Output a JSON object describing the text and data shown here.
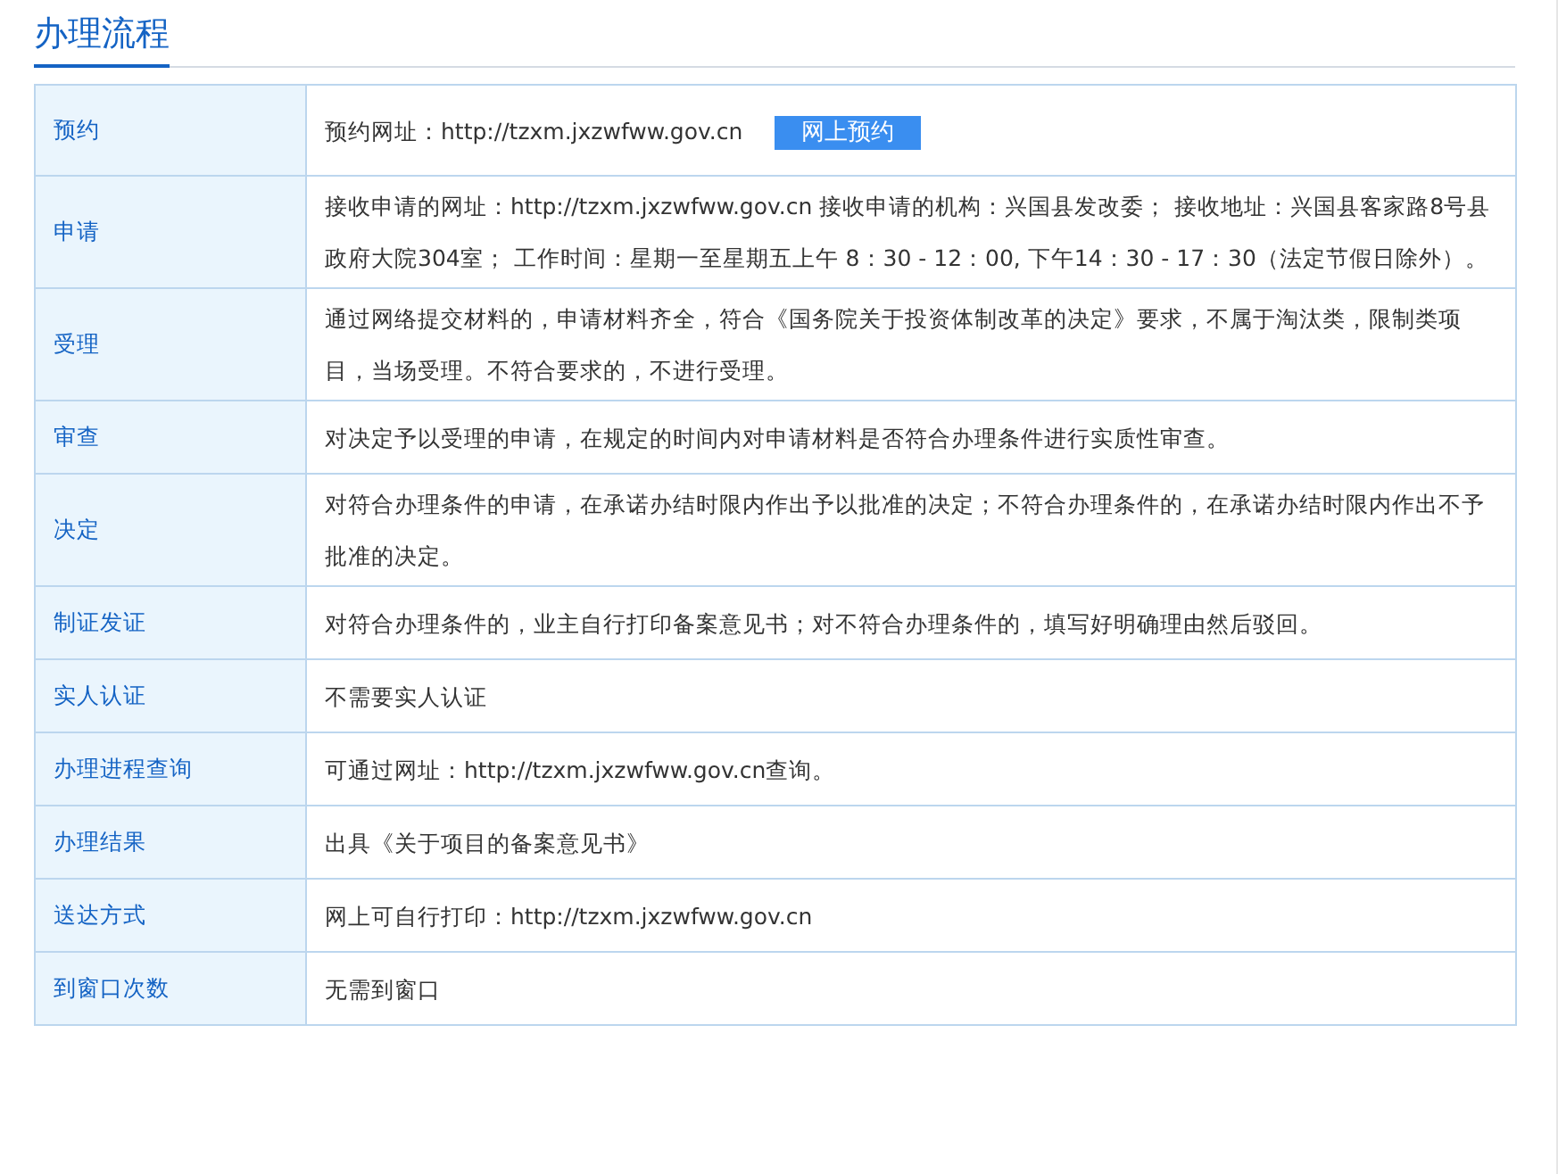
{
  "section_title": "办理流程",
  "rows": [
    {
      "label": "预约",
      "text": "预约网址：http://tzxm.jxzwfww.gov.cn",
      "button": "网上预约"
    },
    {
      "label": "申请",
      "text": "接收申请的网址：http://tzxm.jxzwfww.gov.cn 接收申请的机构：兴国县发改委； 接收地址：兴国县客家路8号县政府大院304室； 工作时间：星期一至星期五上午 8：30 - 12：00, 下午14：30 - 17：30（法定节假日除外）。"
    },
    {
      "label": "受理",
      "text": "通过网络提交材料的，申请材料齐全，符合《国务院关于投资体制改革的决定》要求，不属于淘汰类，限制类项目，当场受理。不符合要求的，不进行受理。"
    },
    {
      "label": "审查",
      "text": "对决定予以受理的申请，在规定的时间内对申请材料是否符合办理条件进行实质性审查。"
    },
    {
      "label": "决定",
      "text": "对符合办理条件的申请，在承诺办结时限内作出予以批准的决定；不符合办理条件的，在承诺办结时限内作出不予批准的决定。"
    },
    {
      "label": "制证发证",
      "text": "对符合办理条件的，业主自行打印备案意见书；对不符合办理条件的，填写好明确理由然后驳回。"
    },
    {
      "label": "实人认证",
      "text": "不需要实人认证"
    },
    {
      "label": "办理进程查询",
      "text": "可通过网址：http://tzxm.jxzwfww.gov.cn查询。"
    },
    {
      "label": "办理结果",
      "text": "出具《关于项目的备案意见书》"
    },
    {
      "label": "送达方式",
      "text": "网上可自行打印：http://tzxm.jxzwfww.gov.cn"
    },
    {
      "label": "到窗口次数",
      "text": "无需到窗口"
    }
  ]
}
